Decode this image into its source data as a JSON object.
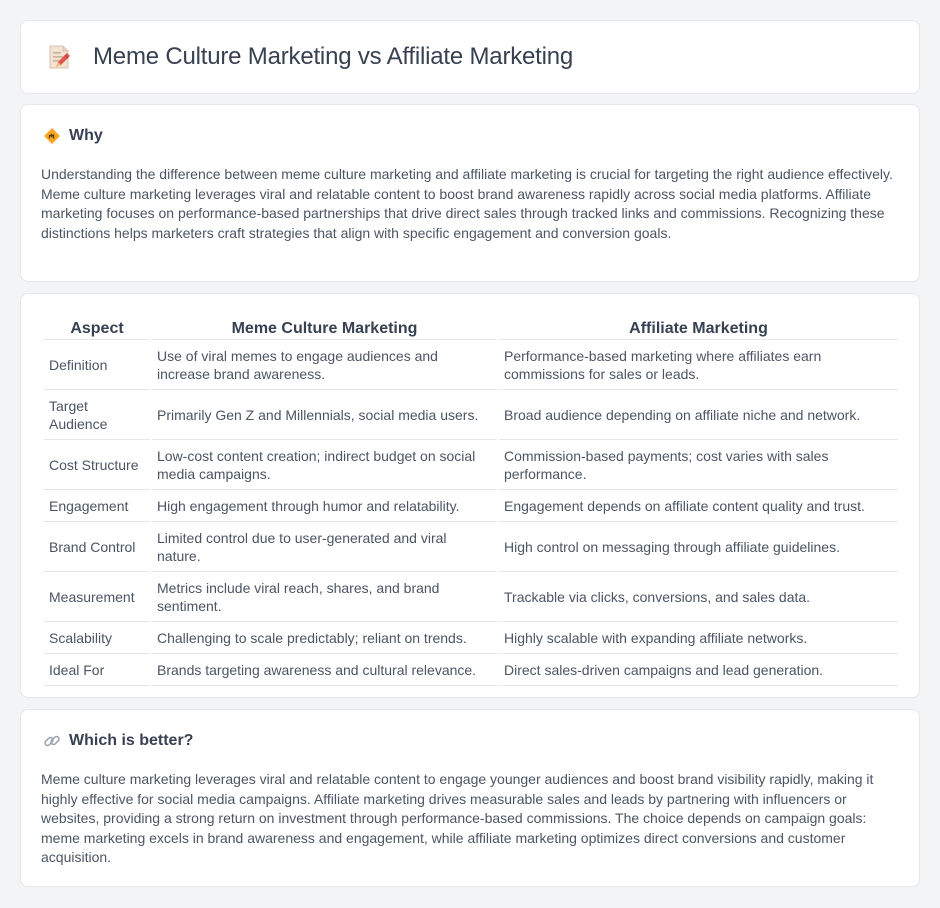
{
  "header": {
    "title": "Meme Culture Marketing vs Affiliate Marketing",
    "icon": "document-pencil-icon"
  },
  "why": {
    "icon": "road-sign-icon",
    "title": "Why",
    "body": "Understanding the difference between meme culture marketing and affiliate marketing is crucial for targeting the right audience effectively. Meme culture marketing leverages viral and relatable content to boost brand awareness rapidly across social media platforms. Affiliate marketing focuses on performance-based partnerships that drive direct sales through tracked links and commissions. Recognizing these distinctions helps marketers craft strategies that align with specific engagement and conversion goals."
  },
  "table": {
    "headers": [
      "Aspect",
      "Meme Culture Marketing",
      "Affiliate Marketing"
    ],
    "rows": [
      [
        "Definition",
        "Use of viral memes to engage audiences and increase brand awareness.",
        "Performance-based marketing where affiliates earn commissions for sales or leads."
      ],
      [
        "Target Audience",
        "Primarily Gen Z and Millennials, social media users.",
        "Broad audience depending on affiliate niche and network."
      ],
      [
        "Cost Structure",
        "Low-cost content creation; indirect budget on social media campaigns.",
        "Commission-based payments; cost varies with sales performance."
      ],
      [
        "Engagement",
        "High engagement through humor and relatability.",
        "Engagement depends on affiliate content quality and trust."
      ],
      [
        "Brand Control",
        "Limited control due to user-generated and viral nature.",
        "High control on messaging through affiliate guidelines."
      ],
      [
        "Measurement",
        "Metrics include viral reach, shares, and brand sentiment.",
        "Trackable via clicks, conversions, and sales data."
      ],
      [
        "Scalability",
        "Challenging to scale predictably; reliant on trends.",
        "Highly scalable with expanding affiliate networks."
      ],
      [
        "Ideal For",
        "Brands targeting awareness and cultural relevance.",
        "Direct sales-driven campaigns and lead generation."
      ]
    ]
  },
  "better": {
    "icon": "link-icon",
    "title": "Which is better?",
    "body": "Meme culture marketing leverages viral and relatable content to engage younger audiences and boost brand visibility rapidly, making it highly effective for social media campaigns. Affiliate marketing drives measurable sales and leads by partnering with influencers or websites, providing a strong return on investment through performance-based commissions. The choice depends on campaign goals: meme marketing excels in brand awareness and engagement, while affiliate marketing optimizes direct conversions and customer acquisition."
  }
}
